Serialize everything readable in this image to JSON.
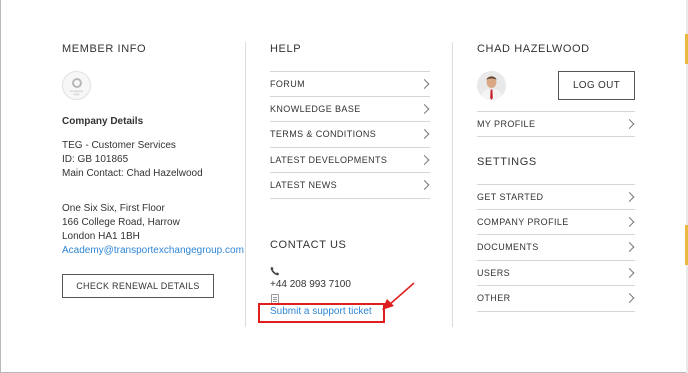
{
  "member_info": {
    "heading": "MEMBER INFO",
    "logo_caption": "Company\nlogo",
    "company_details_label": "Company Details",
    "company_lines": [
      "TEG - Customer Services",
      "ID: GB 101865",
      "Main Contact: Chad Hazelwood"
    ],
    "address_lines": [
      "One Six Six, First Floor",
      "166 College Road, Harrow",
      "London HA1 1BH"
    ],
    "email": "Academy@transportexchangegroup.com",
    "renewal_button": "CHECK RENEWAL DETAILS"
  },
  "help": {
    "heading": "HELP",
    "items": [
      {
        "label": "FORUM"
      },
      {
        "label": "KNOWLEDGE BASE"
      },
      {
        "label": "TERMS & CONDITIONS"
      },
      {
        "label": "LATEST DEVELOPMENTS"
      },
      {
        "label": "LATEST NEWS"
      }
    ]
  },
  "contact": {
    "heading": "CONTACT US",
    "phone": "+44 208 993 7100",
    "support_link": "Submit a support ticket"
  },
  "user": {
    "heading": "CHAD HAZELWOOD",
    "logout_button": "LOG OUT",
    "profile_item": "MY PROFILE"
  },
  "settings": {
    "heading": "SETTINGS",
    "items": [
      {
        "label": "GET STARTED"
      },
      {
        "label": "COMPANY PROFILE"
      },
      {
        "label": "DOCUMENTS"
      },
      {
        "label": "USERS"
      },
      {
        "label": "OTHER"
      }
    ]
  },
  "colors": {
    "link": "#2f86d5",
    "annotation": "#e01e1e",
    "scrollbar_accent": "#e8b93e"
  },
  "icons": [
    "company-logo-icon",
    "phone-icon",
    "document-icon",
    "chevron-right-icon",
    "avatar"
  ]
}
